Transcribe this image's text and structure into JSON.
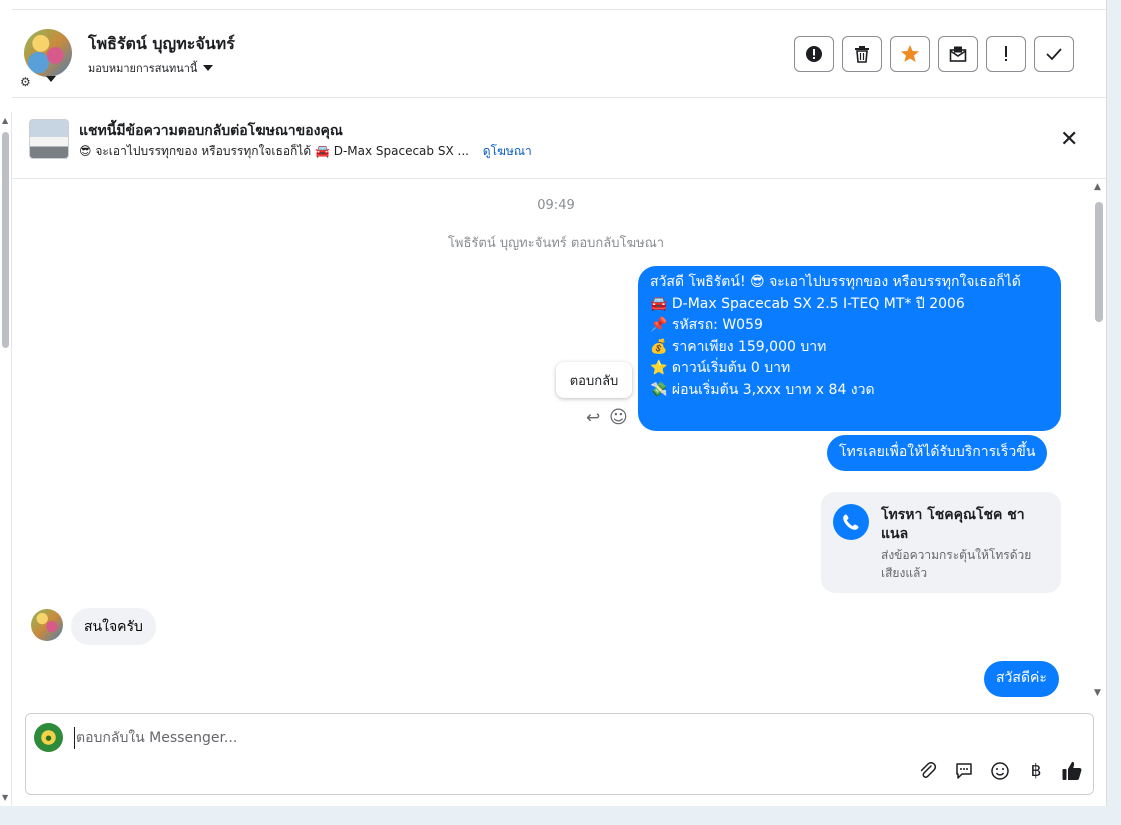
{
  "header": {
    "contact_name": "โพธิรัตน์ บุญทะจันทร์",
    "assign_label": "มอบหมายการสนทนานี้",
    "actions": [
      {
        "name": "alert-button",
        "icon": "exclamation-circle-icon",
        "glyph": "❗"
      },
      {
        "name": "delete-button",
        "icon": "trash-icon",
        "glyph": "🗑"
      },
      {
        "name": "star-button",
        "icon": "star-icon",
        "glyph": "★"
      },
      {
        "name": "mark-unread-button",
        "icon": "envelope-icon",
        "glyph": "✉"
      },
      {
        "name": "spam-button",
        "icon": "exclamation-icon",
        "glyph": "!"
      },
      {
        "name": "done-button",
        "icon": "check-icon",
        "glyph": "✓"
      }
    ],
    "accent_star": "#f08a24"
  },
  "banner": {
    "title": "แชทนี้มีข้อความตอบกลับต่อโฆษณาของคุณ",
    "subtitle": "😎 จะเอาไปบรรทุกของ หรือบรรทุกใจเธอก็ได้ 🚘 D-Max Spacecab SX ...",
    "link_label": "ดูโฆษณา"
  },
  "thread": {
    "time": "09:49",
    "system_note": "โพธิรัตน์ บุญทะจันทร์ ตอบกลับโฆษณา",
    "message1_lines": [
      "สวัสดี โพธิรัตน์! 😎 จะเอาไปบรรทุกของ หรือบรรทุกใจเธอก็ได้",
      "🚘 D-Max Spacecab SX 2.5 I-TEQ MT* ปี 2006",
      " ",
      "📌 รหัสรถ: W059",
      "💰 ราคาเพียง 159,000 บาท",
      "⭐ ดาวน์เริ่มต้น 0 บาท",
      "💸 ผ่อนเริ่มต้น 3,xxx บาท x 84 งวด"
    ],
    "message2": "โทรเลยเพื่อให้ได้รับบริการเร็วขึ้น",
    "call_card": {
      "title": "โทรหา โชคคุณโชค ชาแนล",
      "description": "ส่งข้อความกระตุ้นให้โทรด้วยเสียงแล้ว"
    },
    "tooltip": "ตอบกลับ",
    "incoming_message": "สนใจครับ",
    "message3": "สวัสดีค่ะ",
    "bubble_color": "#0a7cff"
  },
  "composer": {
    "placeholder": "ตอบกลับใน Messenger...",
    "tools": [
      "paperclip-icon",
      "saved-reply-icon",
      "emoji-icon",
      "baht-icon",
      "thumbs-up-icon"
    ]
  }
}
